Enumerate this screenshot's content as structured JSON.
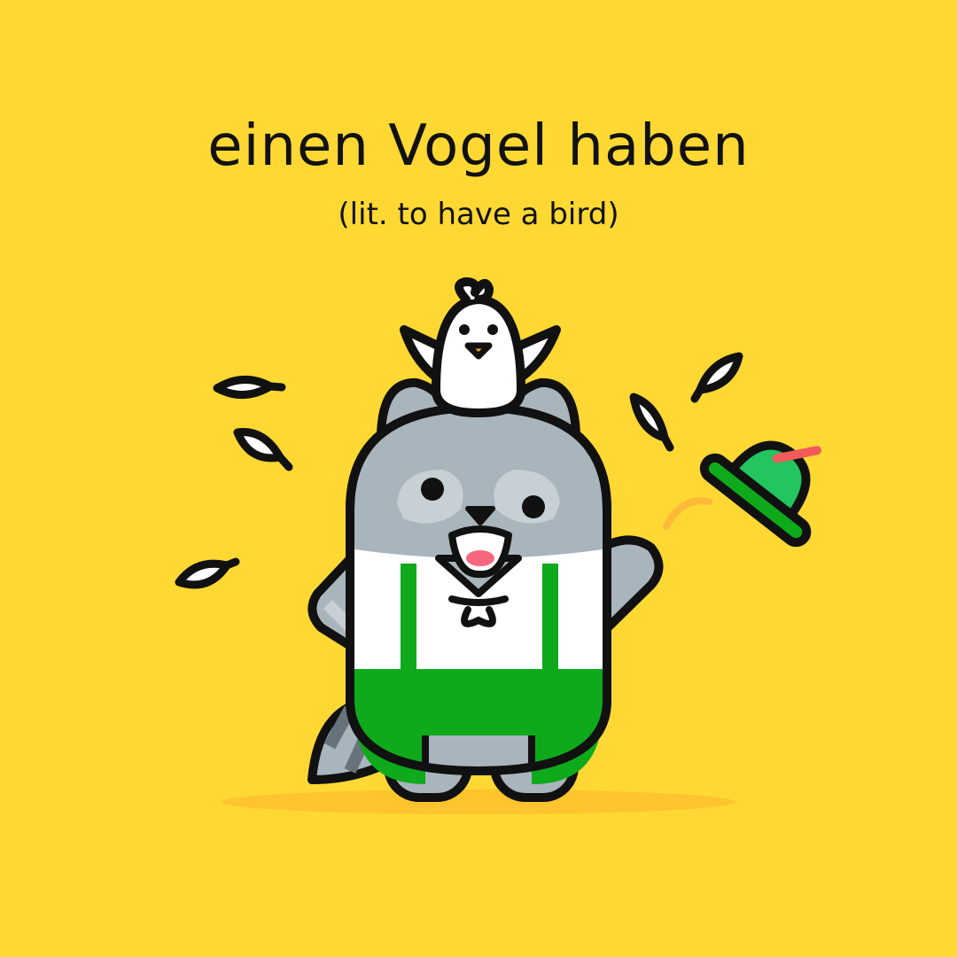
{
  "heading": {
    "title": "einen Vogel haben",
    "subtitle": "(lit. to have a bird)"
  },
  "illustration": {
    "subject": "raccoon-in-lederhosen",
    "companion": "bird-on-head",
    "props": [
      "flying-green-hat",
      "falling-feathers"
    ]
  },
  "colors": {
    "background": "#FFD833",
    "outline": "#111111",
    "fur": "#A9B5BC",
    "fur_light": "#C7D0D4",
    "shirt": "#FFFFFF",
    "lederhosen": "#0FA91C",
    "hat": "#22C55E",
    "hat_feather": "#F25A5A",
    "tongue": "#F7677E",
    "beak": "#F5A623",
    "shadow": "#FFC42E",
    "motion_arc": "#FFB938"
  }
}
